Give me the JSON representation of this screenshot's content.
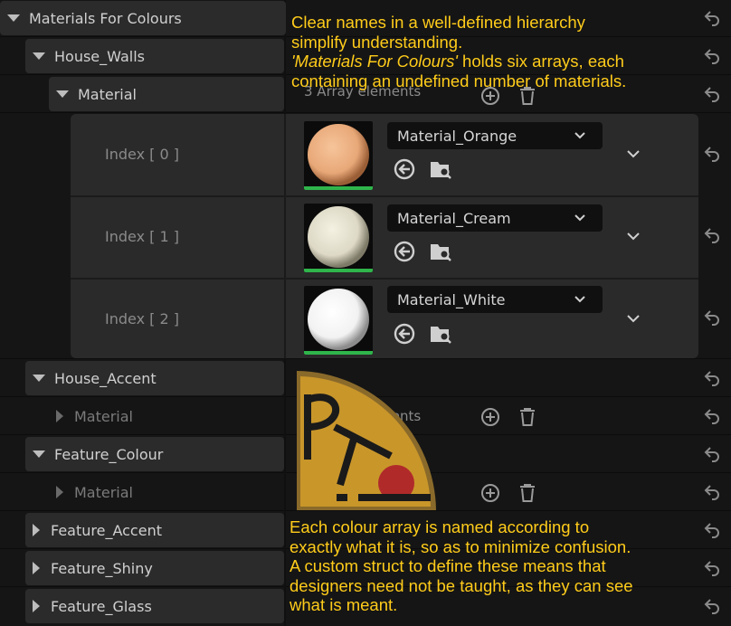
{
  "tree": {
    "root_label": "Materials For Colours",
    "house_walls_label": "House_Walls",
    "material_label": "Material",
    "array_elements_text": "3 Array elements",
    "entries": [
      {
        "index_label": "Index [ 0 ]",
        "material": "Material_Orange",
        "sphere_color": "#e8a878"
      },
      {
        "index_label": "Index [ 1 ]",
        "material": "Material_Cream",
        "sphere_color": "#ddd9c6"
      },
      {
        "index_label": "Index [ 2 ]",
        "material": "Material_White",
        "sphere_color": "#f2f2f2"
      }
    ],
    "house_accent_label": "House_Accent",
    "house_accent_material": "Material",
    "house_accent_array_text": "0 Array elements",
    "feature_colour_label": "Feature_Colour",
    "feature_colour_material": "Material",
    "feature_accent_label": "Feature_Accent",
    "feature_shiny_label": "Feature_Shiny",
    "feature_glass_label": "Feature_Glass"
  },
  "annotations": {
    "top_line1": "Clear names in a well-defined hierarchy",
    "top_line2": "simplify understanding.",
    "top_line3_italic": "'Materials For Colours'",
    "top_line3_rest": " holds six arrays, each",
    "top_line4": "containing an undefined number of materials.",
    "bottom_lines": [
      "Each colour array is named according to",
      "exactly what it is, so as to minimize confusion.",
      "A custom struct to define these means that",
      "designers need not be taught, as they can see",
      "what is meant."
    ]
  },
  "colors": {
    "annotation_text": "#ffcc1a",
    "logo_gold": "#c9962a",
    "logo_red": "#b02a2a",
    "thumbnail_underline": "#2fb54b"
  },
  "icons": [
    "reset-arrow-icon",
    "chevron-down-icon",
    "use-selected-icon",
    "browse-asset-icon",
    "add-element-icon",
    "delete-icon"
  ]
}
